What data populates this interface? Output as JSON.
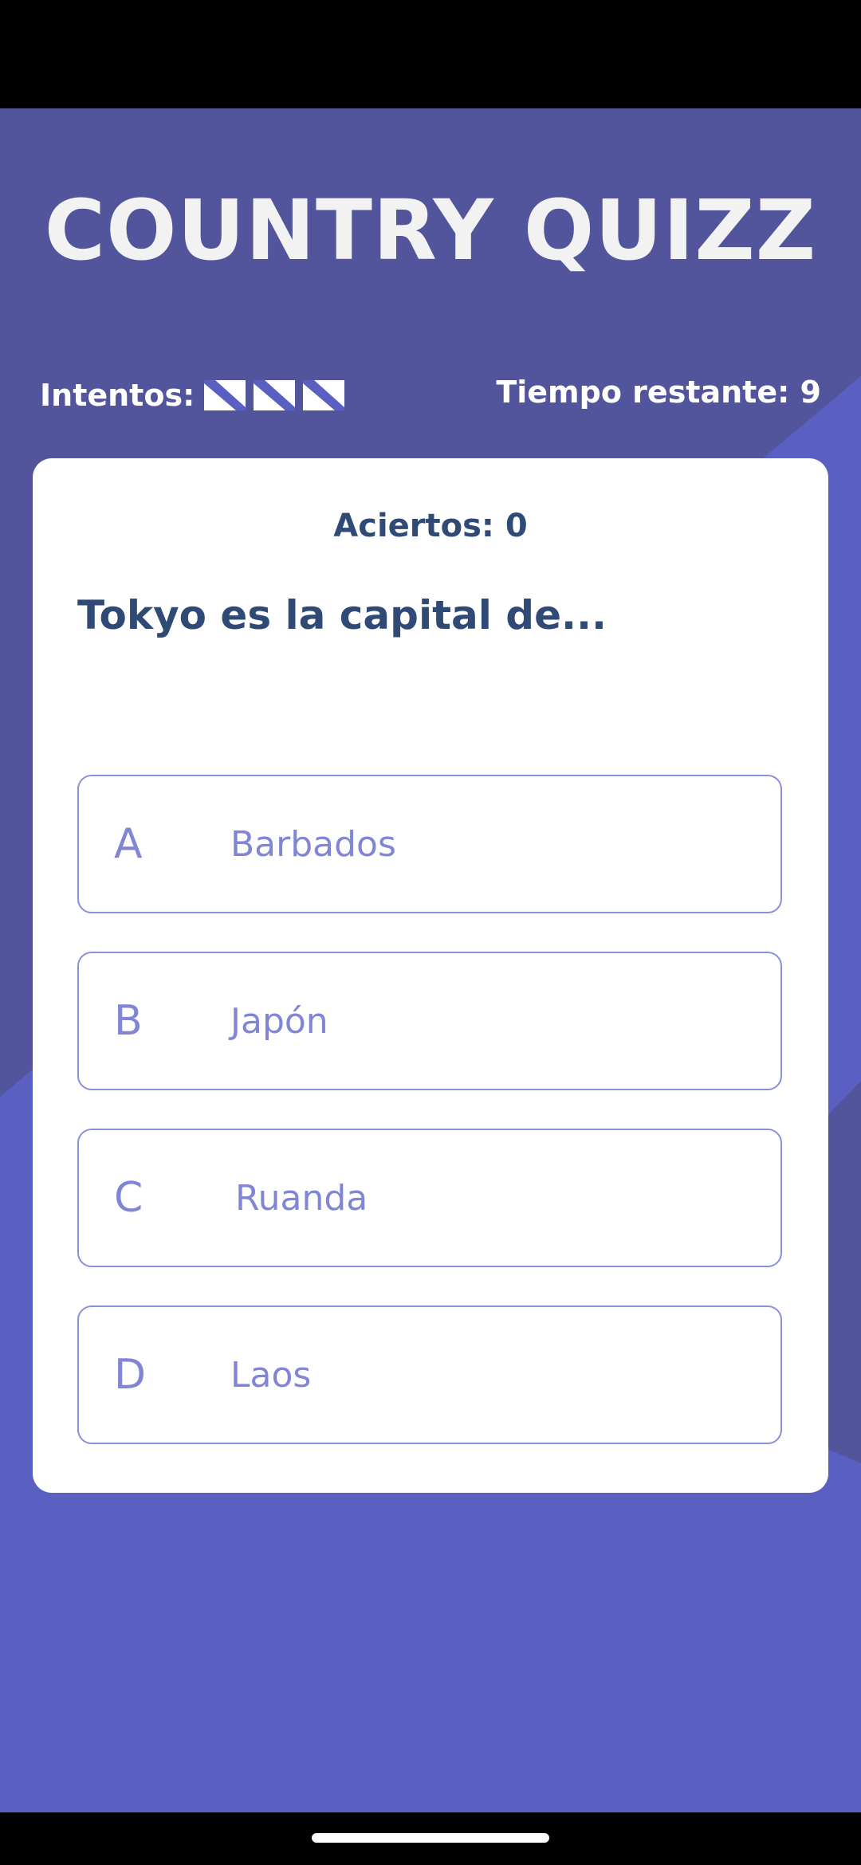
{
  "app": {
    "title": "COUNTRY QUIZZ"
  },
  "stats": {
    "attempts_label": "Intentos:",
    "attempts_remaining": 3,
    "time_label": "Tiempo restante:",
    "time_value": "9"
  },
  "card": {
    "score_label": "Aciertos:",
    "score_value": "0",
    "question": "Tokyo es la capital de...",
    "options": [
      {
        "letter": "A",
        "text": "Barbados"
      },
      {
        "letter": "B",
        "text": "Japón"
      },
      {
        "letter": "C",
        "text": "Ruanda"
      },
      {
        "letter": "D",
        "text": "Laos"
      }
    ]
  },
  "colors": {
    "background": "#5a60c2",
    "background_dark": "#52559c",
    "card": "#ffffff",
    "text_dark": "#2f4a75",
    "option_accent": "#8085d6"
  },
  "icons": {
    "attempt": "striped-flag-icon"
  }
}
